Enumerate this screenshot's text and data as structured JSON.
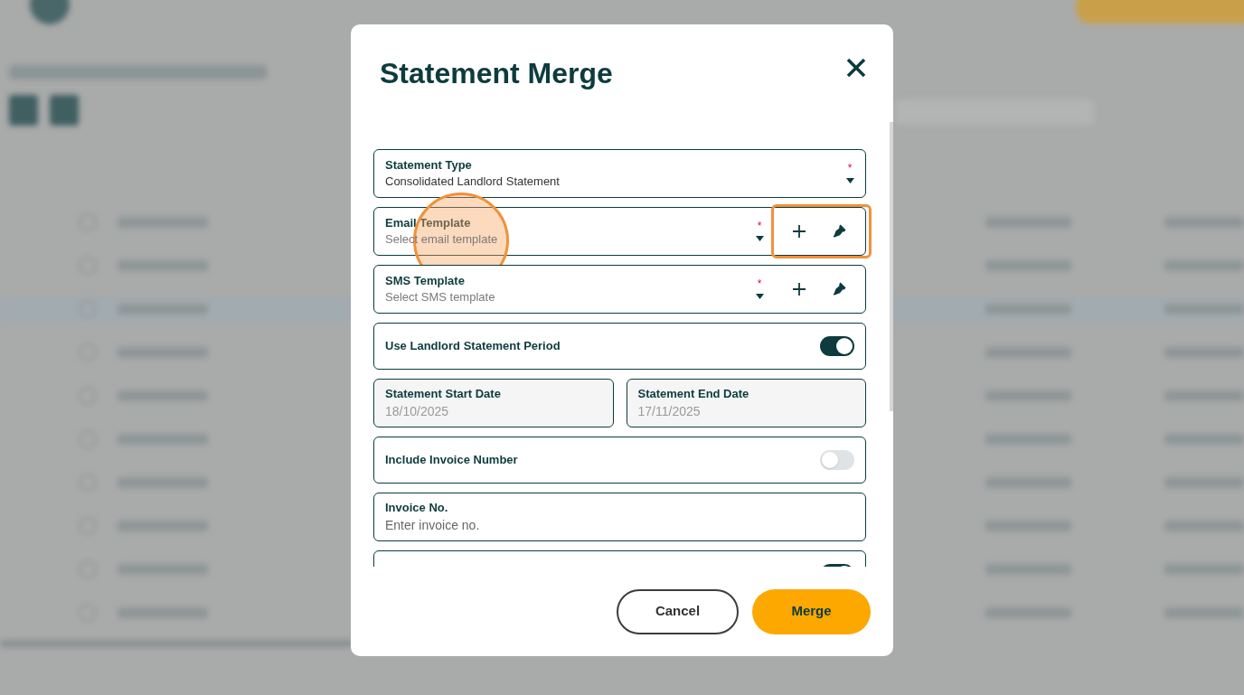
{
  "dialog": {
    "title": "Statement Merge",
    "fields": [
      {
        "kind": "select",
        "label": "Statement Type",
        "value": "Consolidated Landlord Statement",
        "required_mark": "*",
        "actions": false,
        "highlighted": false,
        "clicked": false
      },
      {
        "kind": "select",
        "label": "Email Template",
        "placeholder": "Select email template",
        "required_mark": "*",
        "actions": true,
        "highlighted": true,
        "clicked": true
      },
      {
        "kind": "select",
        "label": "SMS Template",
        "placeholder": "Select SMS template",
        "required_mark": "*",
        "actions": true,
        "highlighted": false,
        "clicked": false
      },
      {
        "kind": "toggle",
        "label": "Use Landlord Statement Period",
        "on": true
      },
      {
        "kind": "dates",
        "items": [
          {
            "label": "Statement Start Date",
            "value": "18/10/2025"
          },
          {
            "label": "Statement End Date",
            "value": "17/11/2025"
          }
        ]
      },
      {
        "kind": "toggle",
        "label": "Include Invoice Number",
        "on": false
      },
      {
        "kind": "text",
        "label": "Invoice No.",
        "placeholder": "Enter invoice no."
      },
      {
        "kind": "toggle",
        "on": true
      }
    ],
    "buttons": [
      {
        "kind": "secondary",
        "label": "Cancel"
      },
      {
        "kind": "primary",
        "label": "Merge"
      }
    ]
  }
}
